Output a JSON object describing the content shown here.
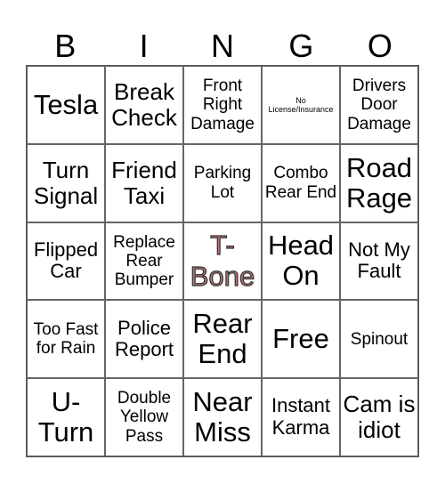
{
  "header": [
    "B",
    "I",
    "N",
    "G",
    "O"
  ],
  "cells": [
    {
      "text": "Tesla",
      "size": "xl"
    },
    {
      "text": "Break Check",
      "size": "lg"
    },
    {
      "text": "Front Right Damage",
      "size": "sm"
    },
    {
      "text": "No License/Insurance",
      "size": "xs"
    },
    {
      "text": "Drivers Door Damage",
      "size": "sm"
    },
    {
      "text": "Turn Signal",
      "size": "lg"
    },
    {
      "text": "Friend Taxi",
      "size": "lg"
    },
    {
      "text": "Parking Lot",
      "size": "sm"
    },
    {
      "text": "Combo Rear End",
      "size": "sm"
    },
    {
      "text": "Road Rage",
      "size": "xl"
    },
    {
      "text": "Flipped Car",
      "size": "md"
    },
    {
      "text": "Replace Rear Bumper",
      "size": "sm"
    },
    {
      "text": "T-Bone",
      "size": "tbone",
      "highlight_color": "#b87272"
    },
    {
      "text": "Head On",
      "size": "xl"
    },
    {
      "text": "Not My Fault",
      "size": "md"
    },
    {
      "text": "Too Fast for Rain",
      "size": "sm"
    },
    {
      "text": "Police Report",
      "size": "md"
    },
    {
      "text": "Rear End",
      "size": "xl"
    },
    {
      "text": "Free",
      "size": "xl"
    },
    {
      "text": "Spinout",
      "size": "sm"
    },
    {
      "text": "U-Turn",
      "size": "xl"
    },
    {
      "text": "Double Yellow Pass",
      "size": "sm"
    },
    {
      "text": "Near Miss",
      "size": "xl"
    },
    {
      "text": "Instant Karma",
      "size": "md"
    },
    {
      "text": "Cam is idiot",
      "size": "lg"
    }
  ]
}
